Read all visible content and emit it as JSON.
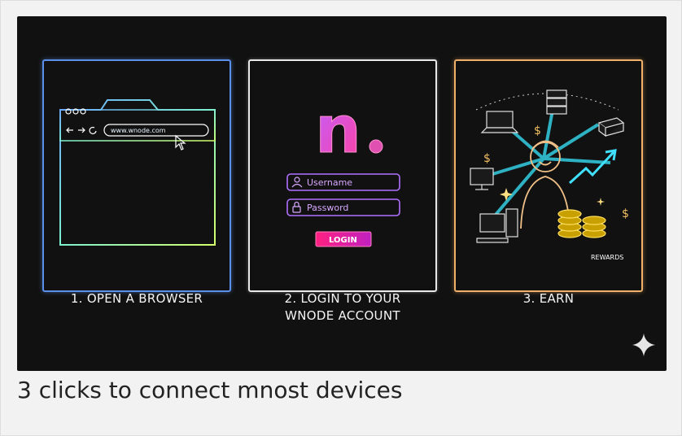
{
  "steps": [
    {
      "label": "1. OPEN A BROWSER"
    },
    {
      "label": "2. LOGIN TO YOUR",
      "label2": "WNODE ACCOUNT"
    },
    {
      "label": "3. EARN"
    }
  ],
  "browser": {
    "url": "www.wnode.com"
  },
  "login": {
    "brand": "n",
    "username_placeholder": "Username",
    "password_placeholder": "Password",
    "button_label": "LOGIN"
  },
  "earn": {
    "rewards_label": "REWARDS"
  },
  "caption": "3 clicks to connect mnost devices",
  "colors": {
    "panel1": "#5b8fe8",
    "panel2": "#e8e8e8",
    "panel3": "#f0b068",
    "brand": "#e040a0",
    "accent": "#a070ff"
  }
}
